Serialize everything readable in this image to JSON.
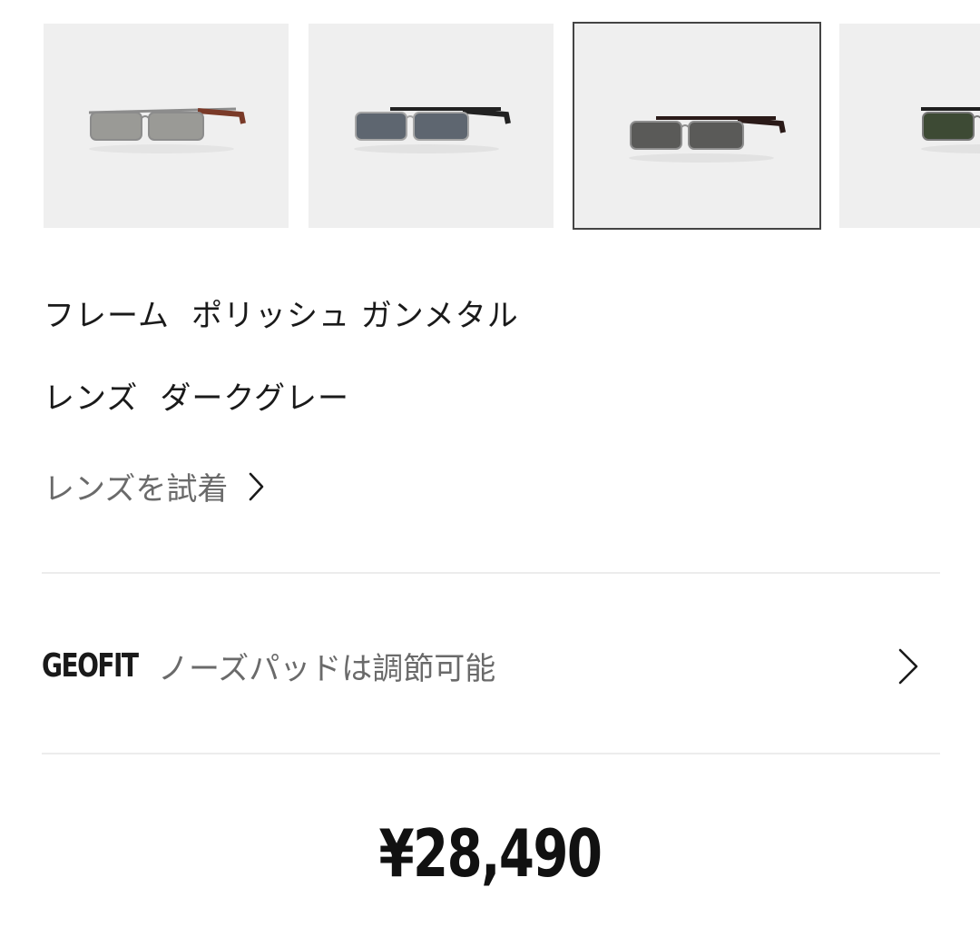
{
  "variants": [
    {
      "name": "gunmetal-grey-mirror",
      "frame_color": "#8c8c8c",
      "lens_color": "#9a9a96",
      "temple_color": "#7a3a28",
      "selected": false
    },
    {
      "name": "silver-blue-grey",
      "frame_color": "#a6a6a6",
      "lens_color": "#5e6670",
      "temple_color": "#222222",
      "selected": false
    },
    {
      "name": "polished-gunmetal-dark-grey",
      "frame_color": "#8f8f8f",
      "lens_color": "#5a5a58",
      "temple_color": "#2a1a18",
      "selected": true
    },
    {
      "name": "gunmetal-green",
      "frame_color": "#7a7a7a",
      "lens_color": "#3d4a34",
      "temple_color": "#1e1e1e",
      "selected": false
    }
  ],
  "details": {
    "frame_label": "フレーム",
    "frame_value": "ポリッシュ ガンメタル",
    "lens_label": "レンズ",
    "lens_value": "ダークグレー"
  },
  "try_on": {
    "label": "レンズを試着"
  },
  "geofit": {
    "brand": "GEOFIT",
    "text": "ノーズパッドは調節可能"
  },
  "price": {
    "value": "¥28,490"
  },
  "colors": {
    "text_primary": "#1a1a1a",
    "text_secondary": "#6a6a6a",
    "thumb_bg": "#efefef",
    "selected_border": "#444444",
    "divider": "#ececec"
  }
}
